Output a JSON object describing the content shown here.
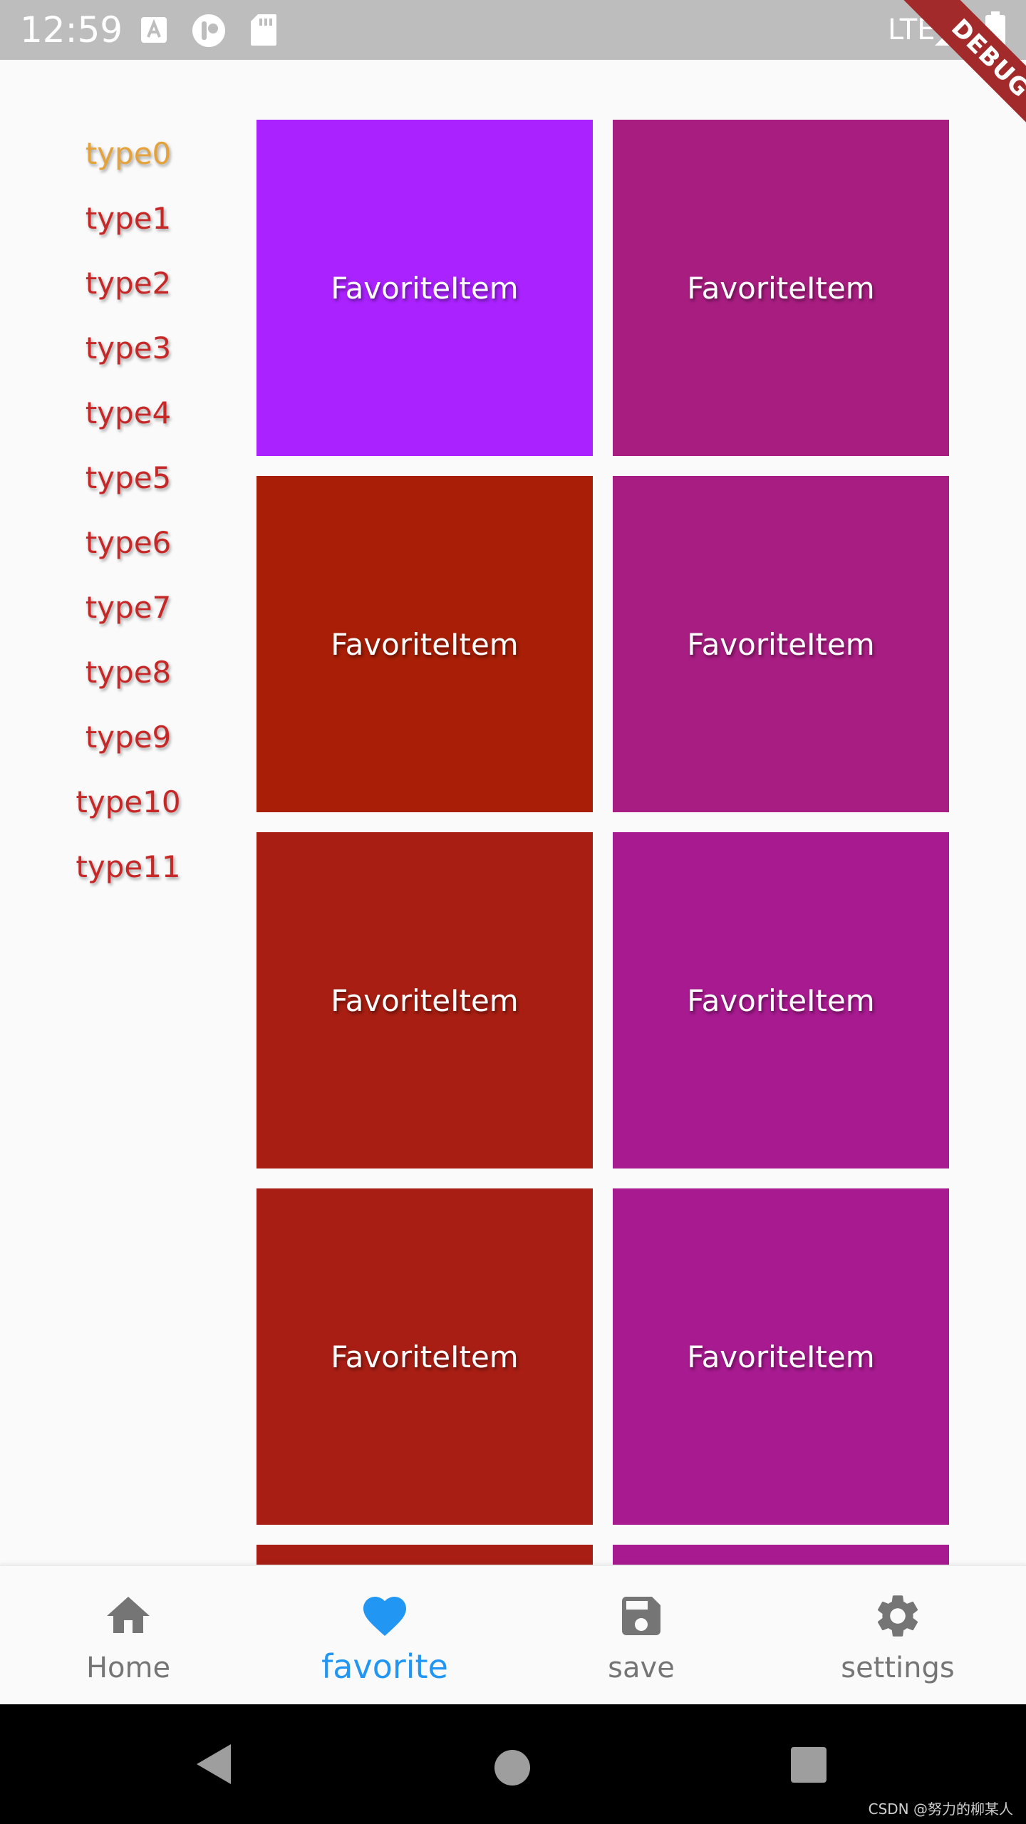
{
  "status_bar": {
    "time": "12:59",
    "network": "LTE",
    "icons": [
      "a-icon",
      "pocket-icon",
      "sd-card-icon",
      "signal-icon",
      "battery-icon"
    ]
  },
  "debug_banner": "DEBUG",
  "type_list": {
    "items": [
      "type0",
      "type1",
      "type2",
      "type3",
      "type4",
      "type5",
      "type6",
      "type7",
      "type8",
      "type9",
      "type10",
      "type11"
    ],
    "active_index": 0,
    "active_color": "#e4a23c",
    "inactive_color": "#c62828"
  },
  "grid": {
    "tiles": [
      {
        "label": "FavoriteItem",
        "color": "#aa22ff"
      },
      {
        "label": "FavoriteItem",
        "color": "#a81d80"
      },
      {
        "label": "FavoriteItem",
        "color": "#a81e06"
      },
      {
        "label": "FavoriteItem",
        "color": "#a81d82"
      },
      {
        "label": "FavoriteItem",
        "color": "#a81e12"
      },
      {
        "label": "FavoriteItem",
        "color": "#a81a90"
      },
      {
        "label": "FavoriteItem",
        "color": "#a81e14"
      },
      {
        "label": "FavoriteItem",
        "color": "#a81a90"
      },
      {
        "label": "",
        "color": "#a81e14"
      },
      {
        "label": "",
        "color": "#a81a90"
      }
    ]
  },
  "bottom_nav": {
    "items": [
      {
        "label": "Home",
        "icon": "home-icon"
      },
      {
        "label": "favorite",
        "icon": "heart-icon"
      },
      {
        "label": "save",
        "icon": "save-icon"
      },
      {
        "label": "settings",
        "icon": "gear-icon"
      }
    ],
    "active_index": 1,
    "active_color": "#2196f3",
    "inactive_color": "#757575"
  },
  "system_nav": {
    "buttons": [
      "back-icon",
      "home-circle-icon",
      "recents-icon"
    ]
  },
  "watermark": "CSDN @努力的柳某人"
}
